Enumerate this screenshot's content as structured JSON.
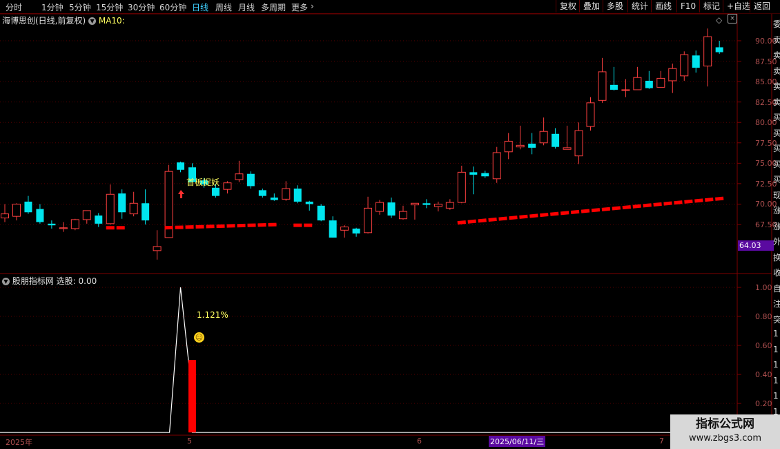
{
  "toolbar": {
    "periods": [
      "分时",
      "1分钟",
      "5分钟",
      "15分钟",
      "30分钟",
      "60分钟",
      "日线",
      "周线",
      "月线",
      "多周期",
      "更多"
    ],
    "active_period": "日线",
    "right_buttons": [
      "复权",
      "叠加",
      "多股",
      "统计",
      "画线",
      "F10",
      "标记",
      "+自选",
      "返回"
    ]
  },
  "main_chart": {
    "title": "海博思创(日线,前复权)",
    "indicator": "MA10:",
    "annotation": "首板捉妖",
    "y_ticks": [
      "90.00",
      "87.50",
      "85.00",
      "82.50",
      "80.00",
      "77.50",
      "75.00",
      "72.50",
      "70.00",
      "67.50"
    ],
    "current_price": "64.03"
  },
  "sub_chart": {
    "title": "股朋指标网",
    "select_label": "选股: 0.00",
    "percent_label": "1.121%",
    "y_ticks": [
      "1.00",
      "0.80",
      "0.60",
      "0.40",
      "0.20"
    ]
  },
  "x_axis": {
    "labels": [
      "2025年",
      "5",
      "6",
      "2025/06/11/三",
      "7"
    ]
  },
  "side_panel": {
    "chars": [
      "委",
      "卖",
      "卖",
      "卖",
      "卖",
      "卖",
      "买",
      "买",
      "买",
      "买",
      "买",
      "现",
      "涨",
      "涨",
      "外",
      "换",
      "收",
      "自",
      "注",
      "突",
      "1",
      "1",
      "1",
      "1",
      "1",
      "1",
      "1",
      "1"
    ]
  },
  "watermark": {
    "line1": "指标公式网",
    "line2": "www.zbgs3.com"
  },
  "colors": {
    "up": "#ff4040",
    "down": "#00e5ee",
    "ma_line": "#ff0000",
    "signal_bar": "#ff0000",
    "axis": "#800000"
  },
  "chart_data": {
    "type": "candlestick",
    "title": "海博思创(日线,前复权)",
    "ylim": [
      64.03,
      91.5
    ],
    "candles": [
      {
        "o": 68.3,
        "h": 70.0,
        "l": 67.8,
        "c": 68.8
      },
      {
        "o": 68.5,
        "h": 70.1,
        "l": 68.0,
        "c": 70.0
      },
      {
        "o": 70.3,
        "h": 71.0,
        "l": 68.8,
        "c": 69.0
      },
      {
        "o": 69.4,
        "h": 70.0,
        "l": 67.6,
        "c": 67.8
      },
      {
        "o": 67.6,
        "h": 68.0,
        "l": 67.0,
        "c": 67.4
      },
      {
        "o": 67.0,
        "h": 67.8,
        "l": 66.6,
        "c": 67.1
      },
      {
        "o": 67.0,
        "h": 68.2,
        "l": 66.8,
        "c": 68.1
      },
      {
        "o": 68.1,
        "h": 69.2,
        "l": 67.6,
        "c": 69.2
      },
      {
        "o": 68.6,
        "h": 68.9,
        "l": 67.2,
        "c": 67.6
      },
      {
        "o": 67.6,
        "h": 72.4,
        "l": 67.5,
        "c": 71.2
      },
      {
        "o": 71.3,
        "h": 71.8,
        "l": 68.2,
        "c": 69.0
      },
      {
        "o": 68.8,
        "h": 71.5,
        "l": 68.5,
        "c": 70.1
      },
      {
        "o": 70.1,
        "h": 71.8,
        "l": 67.5,
        "c": 68.0
      },
      {
        "o": 64.3,
        "h": 66.8,
        "l": 63.2,
        "c": 64.8
      },
      {
        "o": 65.9,
        "h": 74.8,
        "l": 65.9,
        "c": 74.0
      },
      {
        "o": 75.1,
        "h": 75.2,
        "l": 73.9,
        "c": 74.2
      },
      {
        "o": 74.5,
        "h": 75.0,
        "l": 72.7,
        "c": 72.7
      },
      {
        "o": 72.9,
        "h": 73.2,
        "l": 72.0,
        "c": 72.4
      },
      {
        "o": 72.0,
        "h": 72.5,
        "l": 70.8,
        "c": 71.0
      },
      {
        "o": 71.8,
        "h": 72.8,
        "l": 71.3,
        "c": 72.6
      },
      {
        "o": 73.0,
        "h": 75.3,
        "l": 72.7,
        "c": 73.7
      },
      {
        "o": 73.7,
        "h": 74.0,
        "l": 71.9,
        "c": 72.2
      },
      {
        "o": 71.7,
        "h": 71.9,
        "l": 70.8,
        "c": 71.0
      },
      {
        "o": 70.8,
        "h": 71.3,
        "l": 70.4,
        "c": 70.5
      },
      {
        "o": 70.6,
        "h": 72.8,
        "l": 70.4,
        "c": 71.9
      },
      {
        "o": 71.9,
        "h": 72.3,
        "l": 70.1,
        "c": 70.3
      },
      {
        "o": 70.3,
        "h": 70.4,
        "l": 69.2,
        "c": 70.0
      },
      {
        "o": 69.8,
        "h": 70.0,
        "l": 67.9,
        "c": 68.0
      },
      {
        "o": 68.0,
        "h": 68.5,
        "l": 65.9,
        "c": 65.9
      },
      {
        "o": 66.8,
        "h": 67.4,
        "l": 65.9,
        "c": 67.2
      },
      {
        "o": 67.0,
        "h": 67.1,
        "l": 66.0,
        "c": 66.4
      },
      {
        "o": 66.5,
        "h": 70.9,
        "l": 66.4,
        "c": 69.5
      },
      {
        "o": 69.1,
        "h": 70.5,
        "l": 68.7,
        "c": 70.2
      },
      {
        "o": 70.2,
        "h": 70.8,
        "l": 68.3,
        "c": 68.6
      },
      {
        "o": 68.2,
        "h": 69.8,
        "l": 68.1,
        "c": 69.1
      },
      {
        "o": 69.9,
        "h": 70.1,
        "l": 68.1,
        "c": 70.1
      },
      {
        "o": 70.1,
        "h": 70.6,
        "l": 69.5,
        "c": 69.9
      },
      {
        "o": 69.7,
        "h": 70.3,
        "l": 69.1,
        "c": 70.0
      },
      {
        "o": 69.5,
        "h": 70.6,
        "l": 69.3,
        "c": 70.2
      },
      {
        "o": 70.2,
        "h": 74.7,
        "l": 70.1,
        "c": 73.9
      },
      {
        "o": 73.9,
        "h": 74.6,
        "l": 71.2,
        "c": 73.6
      },
      {
        "o": 73.8,
        "h": 74.1,
        "l": 73.2,
        "c": 73.4
      },
      {
        "o": 73.1,
        "h": 77.0,
        "l": 72.6,
        "c": 76.3
      },
      {
        "o": 76.4,
        "h": 78.7,
        "l": 75.5,
        "c": 77.7
      },
      {
        "o": 77.0,
        "h": 79.6,
        "l": 76.7,
        "c": 77.2
      },
      {
        "o": 77.4,
        "h": 78.7,
        "l": 76.1,
        "c": 76.9
      },
      {
        "o": 77.5,
        "h": 80.6,
        "l": 77.2,
        "c": 78.9
      },
      {
        "o": 78.6,
        "h": 79.3,
        "l": 76.8,
        "c": 77.0
      },
      {
        "o": 76.7,
        "h": 79.6,
        "l": 76.7,
        "c": 76.9
      },
      {
        "o": 75.9,
        "h": 80.0,
        "l": 74.9,
        "c": 79.0
      },
      {
        "o": 79.5,
        "h": 83.1,
        "l": 79.0,
        "c": 82.4
      },
      {
        "o": 82.7,
        "h": 87.9,
        "l": 82.4,
        "c": 86.2
      },
      {
        "o": 84.6,
        "h": 86.8,
        "l": 83.9,
        "c": 84.0
      },
      {
        "o": 84.0,
        "h": 85.3,
        "l": 83.1,
        "c": 84.0
      },
      {
        "o": 84.0,
        "h": 86.8,
        "l": 84.0,
        "c": 85.5
      },
      {
        "o": 85.1,
        "h": 86.3,
        "l": 84.1,
        "c": 84.2
      },
      {
        "o": 84.3,
        "h": 86.3,
        "l": 84.3,
        "c": 85.4
      },
      {
        "o": 85.1,
        "h": 87.2,
        "l": 83.6,
        "c": 86.6
      },
      {
        "o": 85.7,
        "h": 88.7,
        "l": 85.1,
        "c": 88.3
      },
      {
        "o": 88.2,
        "h": 88.8,
        "l": 86.1,
        "c": 86.7
      },
      {
        "o": 86.9,
        "h": 91.5,
        "l": 84.4,
        "c": 90.5
      },
      {
        "o": 89.2,
        "h": 90.0,
        "l": 88.4,
        "c": 88.6
      }
    ],
    "ma10_segments": [
      {
        "from": 9,
        "to": 10,
        "value": 67.1
      },
      {
        "from": 14,
        "to": 23,
        "value": 67.1,
        "end": 67.5
      },
      {
        "from": 25,
        "to": 26,
        "value": 67.4
      },
      {
        "from": 39,
        "to": 61,
        "value": 67.7,
        "end": 70.7
      }
    ],
    "sub": {
      "ylim": [
        0,
        1.05
      ],
      "line_peak_index": 15,
      "line_peak_value": 1.0,
      "signal_bar_index": 16,
      "signal_bar_value": 0.5
    }
  }
}
